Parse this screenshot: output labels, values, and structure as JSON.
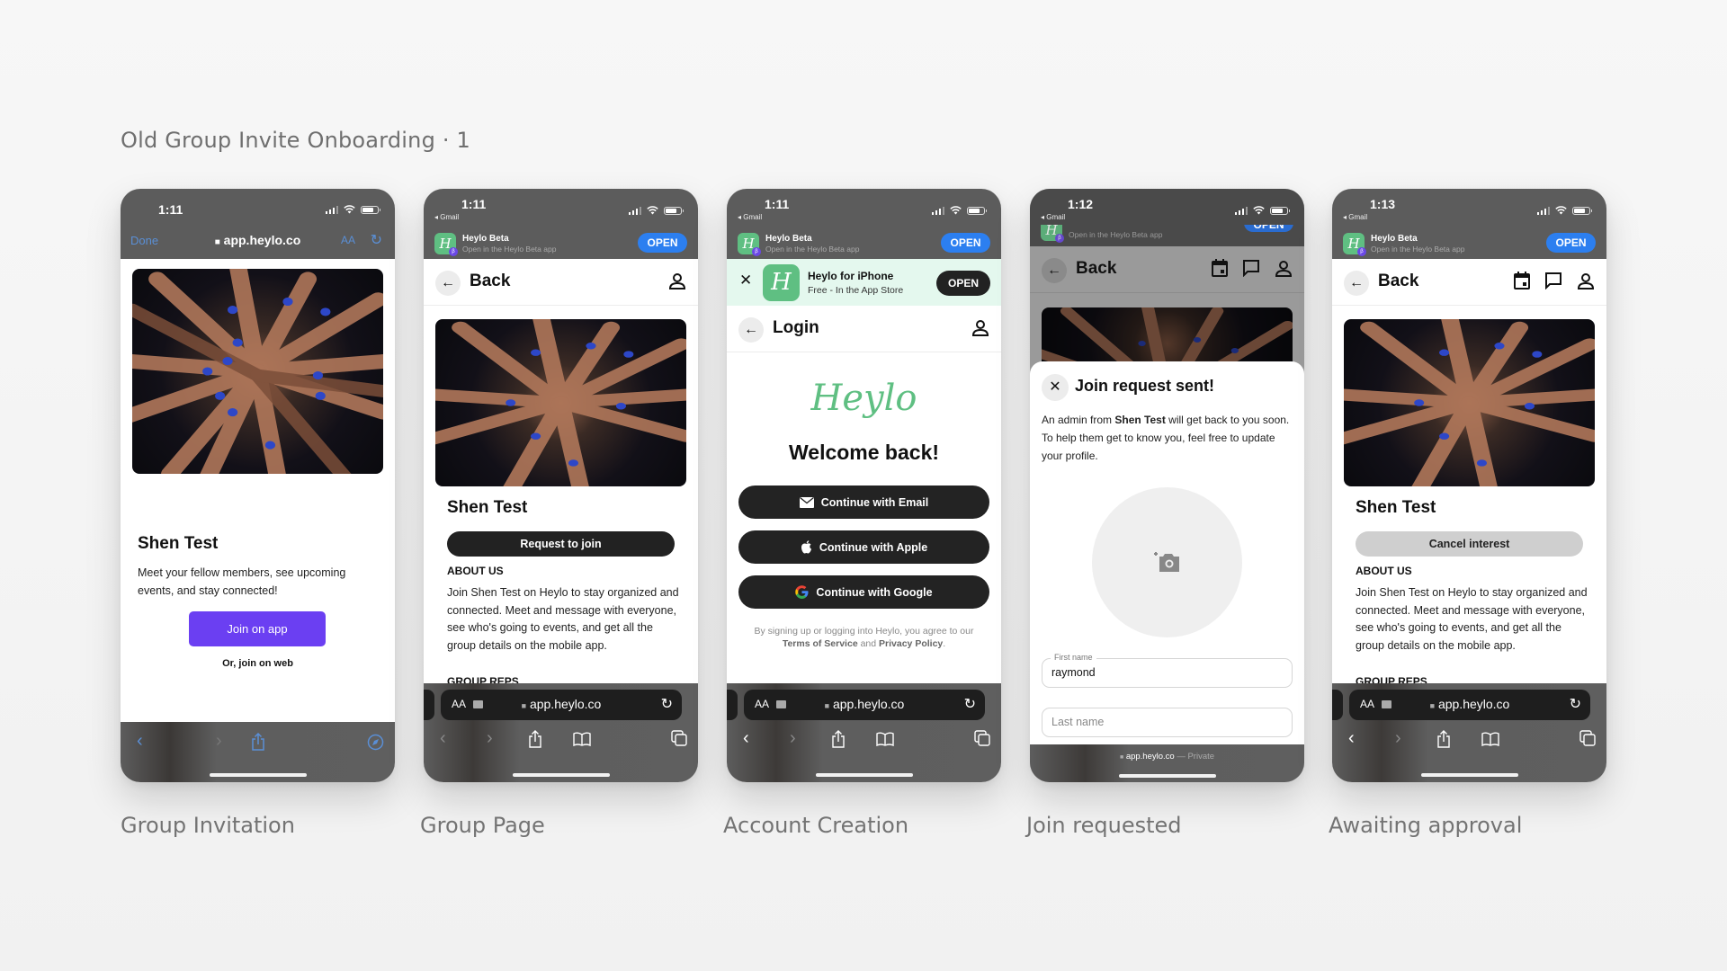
{
  "page": {
    "title": "Old Group Invite Onboarding · 1"
  },
  "status": {
    "signal_icon": "cellular-signal-icon",
    "wifi_icon": "wifi-icon",
    "battery_icon": "battery-icon",
    "back_app": "◂ Gmail"
  },
  "smart_banner": {
    "app_name": "Heylo Beta",
    "subtitle": "Open in the Heylo Beta app",
    "open_label": "OPEN",
    "icon_glyph": "H",
    "beta_glyph": "β"
  },
  "browser": {
    "url": "app.heylo.co",
    "lock_glyph": "🔒",
    "aa_label": "AA",
    "reload_glyph": "↻"
  },
  "group": {
    "name": "Shen Test",
    "about_heading": "ABOUT US",
    "about_text": "Join Shen Test on Heylo to stay organized and connected. Meet and message with everyone, see who's going to events, and get all the group details on the mobile app.",
    "reps_heading": "GROUP REPS",
    "photo_alt": "Group of hands stacked together with blue wristbands"
  },
  "screens": [
    {
      "caption": "Group Invitation",
      "time": "1:11",
      "done_label": "Done",
      "tagline": "Meet your fellow members, see upcoming events, and stay connected!",
      "join_app_label": "Join on app",
      "join_web_label": "Or, join on web"
    },
    {
      "caption": "Group Page",
      "time": "1:11",
      "back_label": "Back",
      "request_label": "Request to join"
    },
    {
      "caption": "Account Creation",
      "time": "1:11",
      "appstore": {
        "title": "Heylo for iPhone",
        "subtitle": "Free - In the App Store",
        "open_label": "OPEN"
      },
      "header_title": "Login",
      "logo_text": "Heylo",
      "welcome": "Welcome back!",
      "buttons": [
        {
          "label": "Continue with Email",
          "icon": "email-icon"
        },
        {
          "label": "Continue with Apple",
          "icon": "apple-icon"
        },
        {
          "label": "Continue with Google",
          "icon": "google-icon"
        }
      ],
      "legal_prefix": "By signing up or logging into Heylo, you agree to our ",
      "terms_label": "Terms of Service",
      "legal_and": " and ",
      "privacy_label": "Privacy Policy",
      "legal_suffix": "."
    },
    {
      "caption": "Join requested",
      "time": "1:12",
      "back_label": "Back",
      "sheet_title": "Join request sent!",
      "sheet_text_1": "An admin from ",
      "sheet_text_bold": "Shen Test",
      "sheet_text_2": " will get back to you soon. To help them get to know you, feel free to update your profile.",
      "first_name_label": "First name",
      "first_name_value": "raymond",
      "last_name_placeholder": "Last name",
      "footer_url": "app.heylo.co",
      "footer_private": " — Private"
    },
    {
      "caption": "Awaiting approval",
      "time": "1:13",
      "back_label": "Back",
      "cancel_label": "Cancel interest"
    }
  ],
  "colors": {
    "brand_green": "#5fbf82",
    "brand_purple": "#6b3ff2",
    "ios_blue": "#2c7ff0",
    "dark_button": "#232323",
    "cancel_grey": "#cfcfcf"
  }
}
